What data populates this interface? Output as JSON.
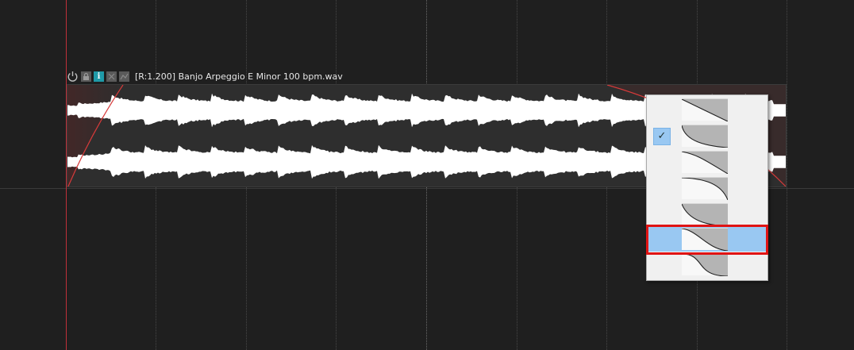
{
  "item": {
    "title": "[R:1.200] Banjo Arpeggio E Minor 100 bpm.wav",
    "info_icon_glyph": "i",
    "icons": [
      "power-icon",
      "lock-icon",
      "info-icon",
      "take-fx-icon",
      "envelope-icon"
    ]
  },
  "fade_menu": {
    "selected_index": 1,
    "highlighted_index": 5,
    "checkmark": "✓",
    "shapes": [
      "linear",
      "fast-start",
      "fast-end",
      "slow-start",
      "slow-end",
      "sharp-curve",
      "s-curve"
    ]
  },
  "colors": {
    "background": "#1f1f1f",
    "waveform": "#ffffff",
    "playhead": "#c0303a",
    "highlight": "#99c8f2",
    "annotation": "#e01414"
  }
}
